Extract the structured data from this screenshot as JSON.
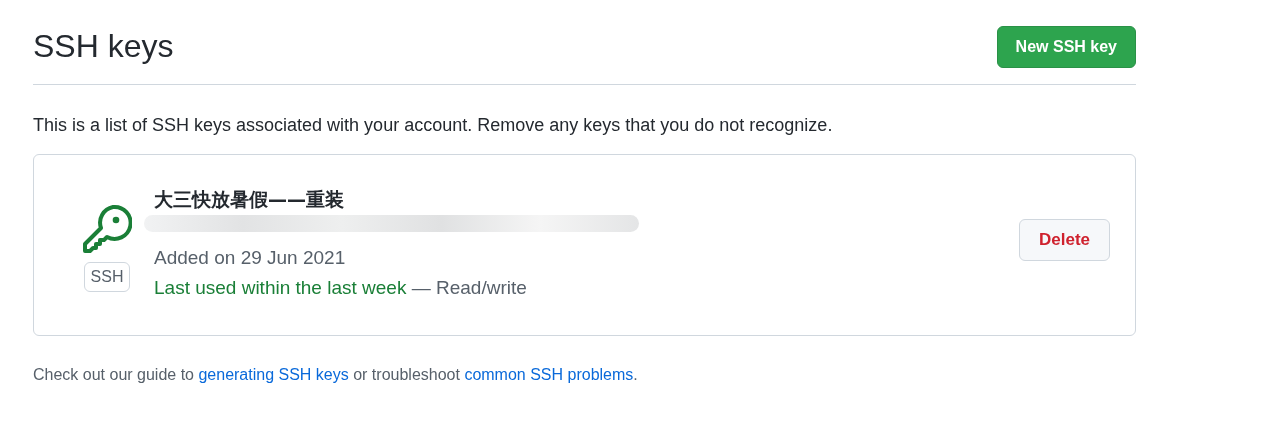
{
  "header": {
    "title": "SSH keys",
    "new_button": "New SSH key"
  },
  "description": "This is a list of SSH keys associated with your account. Remove any keys that you do not recognize.",
  "keys": [
    {
      "title": "大三快放暑假——重装",
      "badge": "SSH",
      "added": "Added on 29 Jun 2021",
      "last_used": "Last used within the last week",
      "access": "— Read/write",
      "delete_button": "Delete"
    }
  ],
  "footer": [
    {
      "kind": "text",
      "text": "Check out our guide to "
    },
    {
      "kind": "link",
      "text": "generating SSH keys"
    },
    {
      "kind": "text",
      "text": " or troubleshoot "
    },
    {
      "kind": "link",
      "text": "common SSH problems"
    },
    {
      "kind": "text",
      "text": "."
    }
  ]
}
